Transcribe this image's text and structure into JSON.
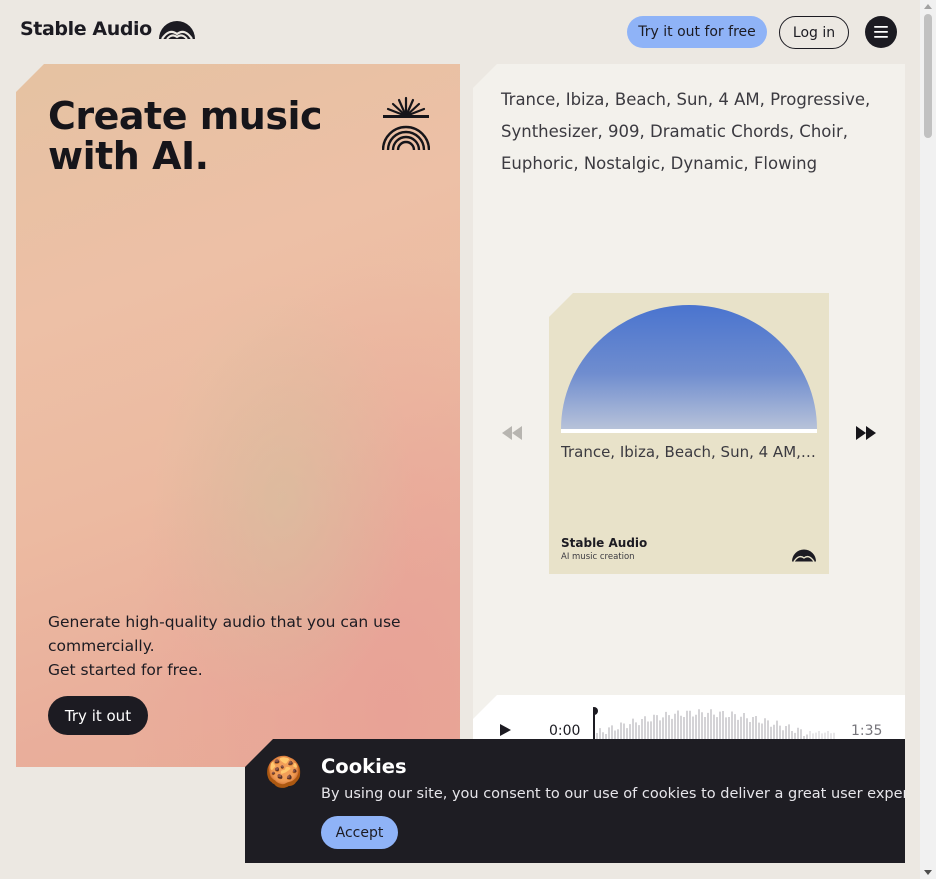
{
  "header": {
    "logo_text": "Stable Audio",
    "try_free_label": "Try it out for free",
    "login_label": "Log in",
    "menu_icon": "hamburger-menu-icon"
  },
  "hero": {
    "title": "Create music with AI.",
    "emblem_icon": "sun-rainbow-icon",
    "description_line1": "Generate high-quality audio that you can use commercially.",
    "description_line2": "Get started for free.",
    "cta_label": "Try it out"
  },
  "player": {
    "prompt": "Trance, Ibiza, Beach, Sun, 4 AM, Progressive, Synthesizer, 909, Dramatic Chords, Choir, Euphoric, Nostalgic, Dynamic, Flowing",
    "track_title": "Trance, Ibiza, Beach, Sun, 4 AM, Progressive, Synthesizer, 909, Dramatic Chords, Choir, Euphoric, Nostalgic, Dynamic, Flowing",
    "card_brand": "Stable Audio",
    "card_subtitle": "AI music creation",
    "prev_icon": "rewind-icon",
    "next_icon": "fast-forward-icon",
    "art_colors": {
      "top": "#4a74cf",
      "bottom": "#b7c2d9"
    }
  },
  "audio": {
    "play_icon": "play-icon",
    "current_time": "0:00",
    "total_time": "1:35",
    "progress": 0
  },
  "cookies": {
    "icon": "cookie-icon",
    "title": "Cookies",
    "text": "By using our site, you consent to our use of cookies to deliver a great user experience.",
    "accept_label": "Accept"
  },
  "colors": {
    "accent": "#8fb3f7",
    "dark": "#1c1b22"
  }
}
